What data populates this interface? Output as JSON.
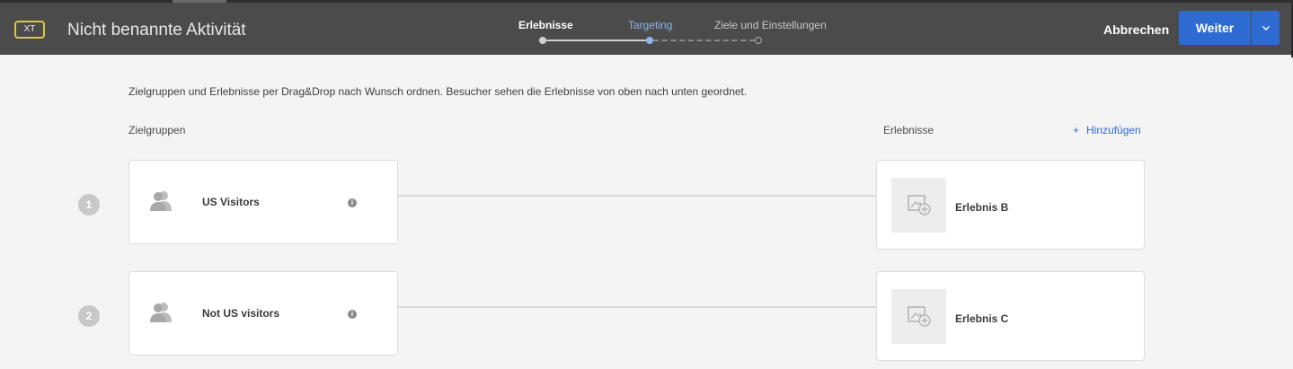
{
  "header": {
    "badge": "XT",
    "title": "Nicht benannte Aktivität",
    "steps": [
      {
        "label": "Erlebnisse",
        "state": "completed"
      },
      {
        "label": "Targeting",
        "state": "active"
      },
      {
        "label": "Ziele und Einstellungen",
        "state": "upcoming"
      }
    ],
    "cancel_label": "Abbrechen",
    "next_label": "Weiter",
    "colors": {
      "bar": "#4b4b4b",
      "primary": "#2d6ad1",
      "active_step": "#8fb4f0",
      "badge_border": "#d6c74a"
    }
  },
  "main": {
    "instructions": "Zielgruppen und Erlebnisse per Drag&Drop nach Wunsch ordnen. Besucher sehen die Erlebnisse von oben nach unten geordnet.",
    "audiences_label": "Zielgruppen",
    "experiences_label": "Erlebnisse",
    "add_plus": "+",
    "add_label": "Hinzufügen",
    "rows": [
      {
        "number": "1",
        "audience": "US Visitors",
        "info_icon": "info-icon",
        "experience": "Erlebnis B"
      },
      {
        "number": "2",
        "audience": "Not US visitors",
        "info_icon": "info-icon",
        "experience": "Erlebnis C"
      }
    ]
  }
}
